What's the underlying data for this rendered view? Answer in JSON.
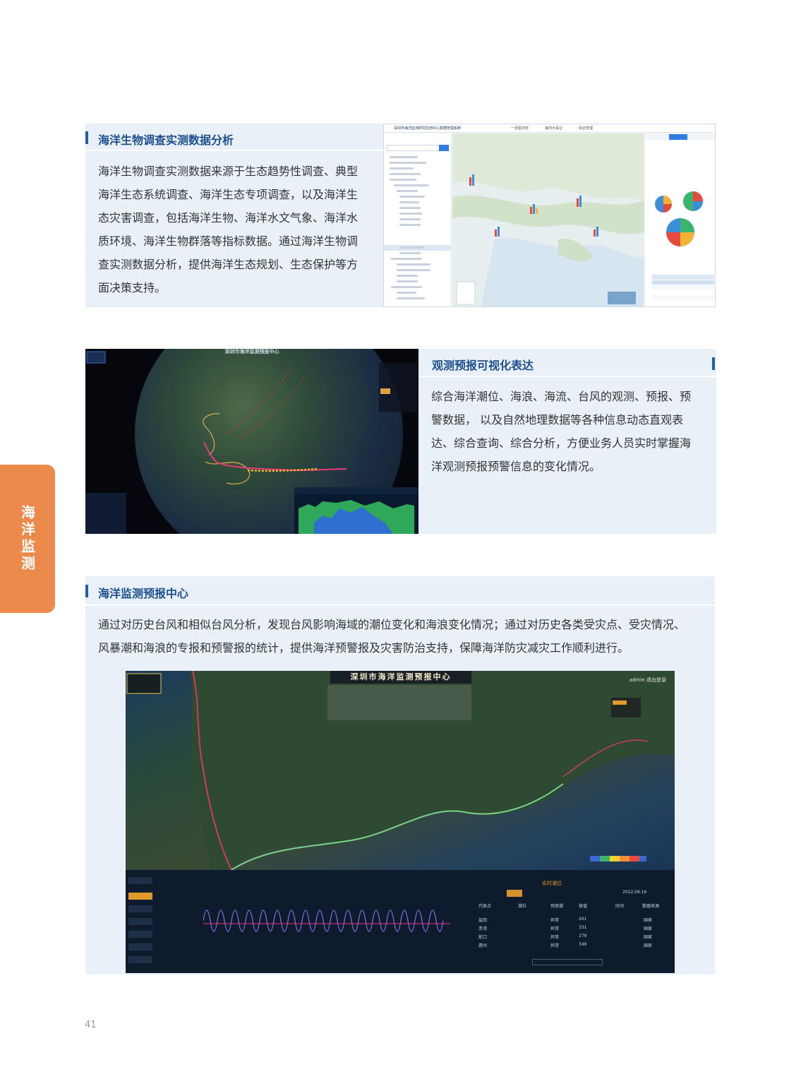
{
  "sections": [
    {
      "title": "海洋生物调查实测数据分析",
      "lines": [
        "海洋生物调查实测数据来源于生态趋势性调查、典型",
        "海洋生态系统调查、海洋生态专项调查，以及海洋生",
        "态灾害调查，包括海洋生物、海洋水文气象、海洋水",
        "质环境、海洋生物群落等指标数据。通过海洋生物调",
        "查实测数据分析，提供海洋生态规划、生态保护等方",
        "面决策支持。"
      ]
    },
    {
      "title": "观测预报可视化表达",
      "lines": [
        "综合海洋潮位、海浪、海流、台风的观测、预报、预",
        "警数据， 以及自然地理数据等各种信息动态直观表",
        "达、综合查询、综合分析，方便业务人员实时掌握海",
        "洋观测预报预警信息的变化情况。"
      ]
    },
    {
      "title": "海洋监测预报中心",
      "lines": [
        "通过对历史台风和相似台风分析，发现台风影响海域的潮位变化和海浪变化情况；通过对历史各类受灾点、受灾情况、",
        "风暴潮和海浪的专报和预警报的统计，提供海洋预警报及灾害防治支持，保障海洋防灾减灾工作顺利进行。"
      ]
    }
  ],
  "side_tab": "海洋监测",
  "page_number": "41",
  "screenshot1": {
    "title": "深圳市海洋监测研究应用中心数据管理系统",
    "tabs": [
      "一张图浏览",
      "海洋大事记",
      "综合管理"
    ]
  },
  "screenshot2": {
    "title": "深圳市海洋监测预报中心"
  },
  "screenshot3": {
    "title": "深圳市海洋监测预报中心",
    "user": "admin 退出登录",
    "panel_title": "实时潮位",
    "date": "2022.09.16",
    "table_headers": [
      "代表点",
      "潮位",
      "预测潮",
      "极值",
      "时间",
      "数据来源"
    ],
    "rows": [
      [
        "盐田",
        "",
        "异常",
        "261",
        "",
        "国家"
      ],
      [
        "赤湾",
        "",
        "异常",
        "331",
        "",
        "国家"
      ],
      [
        "蛇口",
        "",
        "异常",
        "279",
        "",
        "国家"
      ],
      [
        "惠州",
        "",
        "异常",
        "349",
        "",
        "国家"
      ]
    ]
  },
  "colors": {
    "accent": "#1f5fae",
    "panel": "#e9f0f8",
    "side_tab": "#ec8a4c"
  }
}
